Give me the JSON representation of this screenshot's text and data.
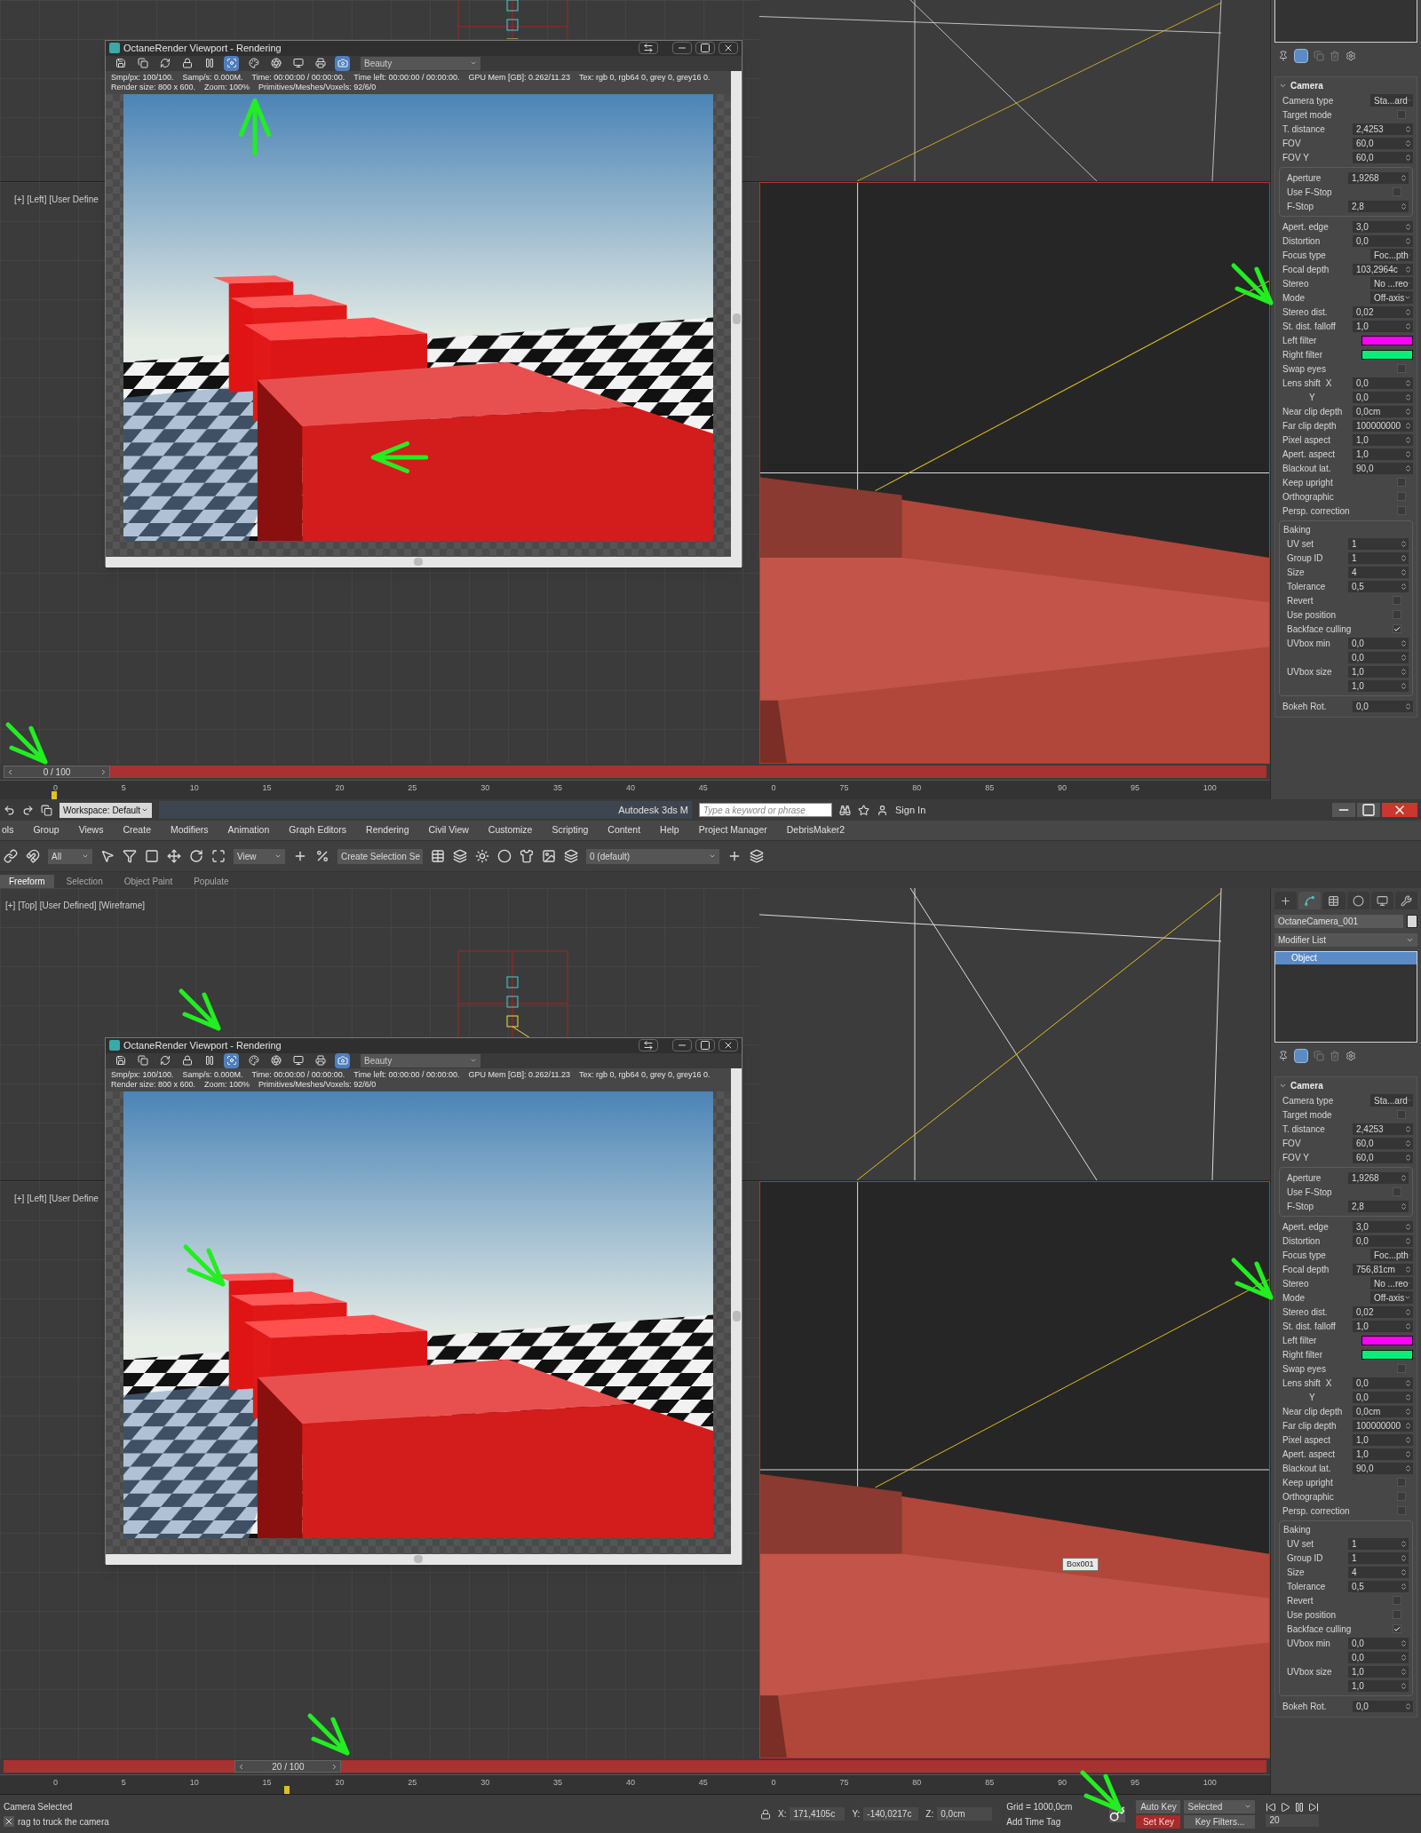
{
  "captures": [
    {
      "left_view_label": "[+] [Left] [User Define",
      "render_window": {
        "title": "OctaneRender Viewport - Rendering",
        "toolbar": [
          {
            "active": false
          },
          {
            "active": false
          },
          {
            "active": false
          },
          {
            "active": false
          },
          {
            "active": false
          },
          {
            "active": true
          },
          {
            "active": false
          },
          {
            "active": false
          },
          {
            "active": false
          },
          {
            "active": false
          },
          {
            "active": true
          }
        ],
        "pass": "Beauty",
        "stats_lines": [
          [
            "Smp/px: 100/100.",
            "Samp/s: 0.000M.",
            "Time: 00:00:00 / 00:00:00.",
            "Time left: 00:00:00 / 00:00:00.",
            "GPU Mem [GB]: 0.262/11.23",
            "Tex: rgb 0, rgb64 0, grey 0, grey16 0."
          ],
          [
            "Render size: 800 x 600.",
            "Zoom: 100%",
            "Primitives/Meshes/Voxels: 92/6/0"
          ]
        ]
      },
      "command_panel": {
        "camera": {
          "title": "Camera",
          "rows": [
            {
              "kind": "dropdown",
              "label": "Camera type",
              "value": "Sta...ard"
            },
            {
              "kind": "checkbox",
              "label": "Target mode",
              "checked": false
            },
            {
              "kind": "spinner",
              "label": "T. distance",
              "value": "2,4253"
            },
            {
              "kind": "spinner",
              "label": "FOV",
              "value": "60,0"
            },
            {
              "kind": "spinner",
              "label": "FOV Y",
              "value": "60,0"
            },
            {
              "kind": "group",
              "rows": [
                {
                  "kind": "spinner",
                  "label": "Aperture",
                  "value": "1,9268"
                },
                {
                  "kind": "checkbox",
                  "label": "Use F-Stop",
                  "checked": false
                },
                {
                  "kind": "spinner",
                  "label": "F-Stop",
                  "value": "2,8"
                }
              ]
            },
            {
              "kind": "spinner",
              "label": "Apert. edge",
              "value": "3,0"
            },
            {
              "kind": "spinner",
              "label": "Distortion",
              "value": "0,0"
            },
            {
              "kind": "dropdown",
              "label": "Focus type",
              "value": "Foc...pth"
            },
            {
              "kind": "spinner",
              "label": "Focal depth",
              "value": "103,2964c"
            },
            {
              "kind": "dropdown",
              "label": "Stereo",
              "value": "No ...reo"
            },
            {
              "kind": "dropdown",
              "label": "Mode",
              "value": "Off-axis"
            },
            {
              "kind": "spinner",
              "label": "Stereo dist.",
              "value": "0,02"
            },
            {
              "kind": "spinner",
              "label": "St. dist. falloff",
              "value": "1,0"
            },
            {
              "kind": "color",
              "label": "Left filter",
              "color": "#ff00ff"
            },
            {
              "kind": "color",
              "label": "Right filter",
              "color": "#00f07a"
            },
            {
              "kind": "checkbox",
              "label": "Swap eyes",
              "checked": false
            },
            {
              "kind": "spinner",
              "label": "Lens shift",
              "sublabel": "X",
              "value": "0,0"
            },
            {
              "kind": "spinner",
              "sublabel": "Y",
              "value": "0,0"
            },
            {
              "kind": "spinner",
              "label": "Near clip depth",
              "value": "0,0cm"
            },
            {
              "kind": "spinner",
              "label": "Far clip depth",
              "value": "100000000"
            },
            {
              "kind": "spinner",
              "label": "Pixel aspect",
              "value": "1,0"
            },
            {
              "kind": "spinner",
              "label": "Apert. aspect",
              "value": "1,0"
            },
            {
              "kind": "spinner",
              "label": "Blackout lat.",
              "value": "90,0"
            },
            {
              "kind": "checkbox",
              "label": "Keep upright",
              "checked": false
            },
            {
              "kind": "checkbox",
              "label": "Orthographic",
              "checked": false
            },
            {
              "kind": "checkbox",
              "label": "Persp. correction",
              "checked": false
            },
            {
              "kind": "group",
              "title": "Baking",
              "rows": [
                {
                  "kind": "spinner",
                  "label": "UV set",
                  "value": "1"
                },
                {
                  "kind": "spinner",
                  "label": "Group ID",
                  "value": "1"
                },
                {
                  "kind": "spinner",
                  "label": "Size",
                  "value": "4"
                },
                {
                  "kind": "spinner",
                  "label": "Tolerance",
                  "value": "0,5"
                },
                {
                  "kind": "checkbox",
                  "label": "Revert",
                  "checked": false
                },
                {
                  "kind": "checkbox",
                  "label": "Use position",
                  "checked": false
                },
                {
                  "kind": "checkbox",
                  "label": "Backface culling",
                  "checked": true
                },
                {
                  "kind": "spinner",
                  "label": "UVbox min",
                  "value": "0,0"
                },
                {
                  "kind": "spinner",
                  "value": "0,0"
                },
                {
                  "kind": "spinner",
                  "label": "UVbox size",
                  "value": "1,0"
                },
                {
                  "kind": "spinner",
                  "value": "1,0"
                }
              ]
            },
            {
              "kind": "spinner",
              "label": "Bokeh Rot.",
              "value": "0,0"
            }
          ]
        }
      },
      "timeline": {
        "label": "0 / 100",
        "level": 0,
        "ticks": [
          "0",
          "5",
          "10",
          "15",
          "20",
          "25",
          "30",
          "35",
          "40",
          "45",
          "0",
          "75",
          "80",
          "85",
          "90",
          "95",
          "100"
        ]
      }
    },
    {
      "top_view_label": "[+] [Top] [User Defined] [Wireframe]",
      "left_view_label": "[+] [Left] [User Define",
      "tooltip": "Box001",
      "render_window": {
        "title": "OctaneRender Viewport - Rendering",
        "toolbar": [
          {
            "active": false
          },
          {
            "active": false
          },
          {
            "active": false
          },
          {
            "active": false
          },
          {
            "active": false
          },
          {
            "active": true
          },
          {
            "active": false
          },
          {
            "active": false
          },
          {
            "active": false
          },
          {
            "active": false
          },
          {
            "active": true
          }
        ],
        "pass": "Beauty",
        "stats_lines": [
          [
            "Smp/px: 100/100.",
            "Samp/s: 0.000M.",
            "Time: 00:00:00 / 00:00:00.",
            "Time left: 00:00:00 / 00:00:00.",
            "GPU Mem [GB]: 0.262/11.23",
            "Tex: rgb 0, rgb64 0, grey 0, grey16 0."
          ],
          [
            "Render size: 800 x 600.",
            "Zoom: 100%",
            "Primitives/Meshes/Voxels: 92/6/0"
          ]
        ]
      },
      "command_panel": {
        "tabs": [
          {
            "selected": false
          },
          {
            "selected": true
          },
          {
            "selected": false
          },
          {
            "selected": false
          },
          {
            "selected": false
          },
          {
            "selected": false
          }
        ],
        "object_name": "OctaneCamera_001",
        "modifier_list": "Modifier List",
        "stack": [
          {
            "label": "Object",
            "selected": true
          }
        ],
        "camera": {
          "title": "Camera",
          "rows": [
            {
              "kind": "dropdown",
              "label": "Camera type",
              "value": "Sta...ard"
            },
            {
              "kind": "checkbox",
              "label": "Target mode",
              "checked": false
            },
            {
              "kind": "spinner",
              "label": "T. distance",
              "value": "2,4253"
            },
            {
              "kind": "spinner",
              "label": "FOV",
              "value": "60,0"
            },
            {
              "kind": "spinner",
              "label": "FOV Y",
              "value": "60,0"
            },
            {
              "kind": "group",
              "rows": [
                {
                  "kind": "spinner",
                  "label": "Aperture",
                  "value": "1,9268"
                },
                {
                  "kind": "checkbox",
                  "label": "Use F-Stop",
                  "checked": false
                },
                {
                  "kind": "spinner",
                  "label": "F-Stop",
                  "value": "2,8"
                }
              ]
            },
            {
              "kind": "spinner",
              "label": "Apert. edge",
              "value": "3,0"
            },
            {
              "kind": "spinner",
              "label": "Distortion",
              "value": "0,0"
            },
            {
              "kind": "dropdown",
              "label": "Focus type",
              "value": "Foc...pth"
            },
            {
              "kind": "spinner",
              "label": "Focal depth",
              "value": "756,81cm"
            },
            {
              "kind": "dropdown",
              "label": "Stereo",
              "value": "No ...reo"
            },
            {
              "kind": "dropdown",
              "label": "Mode",
              "value": "Off-axis"
            },
            {
              "kind": "spinner",
              "label": "Stereo dist.",
              "value": "0,02"
            },
            {
              "kind": "spinner",
              "label": "St. dist. falloff",
              "value": "1,0"
            },
            {
              "kind": "color",
              "label": "Left filter",
              "color": "#ff00ff"
            },
            {
              "kind": "color",
              "label": "Right filter",
              "color": "#00f07a"
            },
            {
              "kind": "checkbox",
              "label": "Swap eyes",
              "checked": false
            },
            {
              "kind": "spinner",
              "label": "Lens shift",
              "sublabel": "X",
              "value": "0,0"
            },
            {
              "kind": "spinner",
              "sublabel": "Y",
              "value": "0,0"
            },
            {
              "kind": "spinner",
              "label": "Near clip depth",
              "value": "0,0cm"
            },
            {
              "kind": "spinner",
              "label": "Far clip depth",
              "value": "100000000"
            },
            {
              "kind": "spinner",
              "label": "Pixel aspect",
              "value": "1,0"
            },
            {
              "kind": "spinner",
              "label": "Apert. aspect",
              "value": "1,0"
            },
            {
              "kind": "spinner",
              "label": "Blackout lat.",
              "value": "90,0"
            },
            {
              "kind": "checkbox",
              "label": "Keep upright",
              "checked": false
            },
            {
              "kind": "checkbox",
              "label": "Orthographic",
              "checked": false
            },
            {
              "kind": "checkbox",
              "label": "Persp. correction",
              "checked": false
            },
            {
              "kind": "group",
              "title": "Baking",
              "rows": [
                {
                  "kind": "spinner",
                  "label": "UV set",
                  "value": "1"
                },
                {
                  "kind": "spinner",
                  "label": "Group ID",
                  "value": "1"
                },
                {
                  "kind": "spinner",
                  "label": "Size",
                  "value": "4"
                },
                {
                  "kind": "spinner",
                  "label": "Tolerance",
                  "value": "0,5"
                },
                {
                  "kind": "checkbox",
                  "label": "Revert",
                  "checked": false
                },
                {
                  "kind": "checkbox",
                  "label": "Use position",
                  "checked": false
                },
                {
                  "kind": "checkbox",
                  "label": "Backface culling",
                  "checked": true
                },
                {
                  "kind": "spinner",
                  "label": "UVbox min",
                  "value": "0,0"
                },
                {
                  "kind": "spinner",
                  "value": "0,0"
                },
                {
                  "kind": "spinner",
                  "label": "UVbox size",
                  "value": "1,0"
                },
                {
                  "kind": "spinner",
                  "value": "1,0"
                }
              ]
            },
            {
              "kind": "spinner",
              "label": "Bokeh Rot.",
              "value": "0,0"
            }
          ]
        }
      },
      "timeline": {
        "label": "20 / 100",
        "level": 0.2,
        "ticks": [
          "0",
          "5",
          "10",
          "15",
          "20",
          "25",
          "30",
          "35",
          "40",
          "45",
          "0",
          "75",
          "80",
          "85",
          "90",
          "95",
          "100"
        ]
      }
    }
  ],
  "app_chrome": {
    "workspace": "Workspace: Default",
    "app_title": "Autodesk 3ds M",
    "search_placeholder": "Type a keyword or phrase",
    "sign_in": "Sign In",
    "menu": [
      "ols",
      "Group",
      "Views",
      "Create",
      "Modifiers",
      "Animation",
      "Graph Editors",
      "Rendering",
      "Civil View",
      "Customize",
      "Scripting",
      "Content",
      "Help",
      "Project Manager",
      "DebrisMaker2"
    ],
    "selection_filter": "All",
    "coord_system": "View",
    "selection_set": "Create Selection Se",
    "layer": "0 (default)",
    "ribbon_tabs": [
      {
        "label": "Freeform",
        "selected": true
      },
      {
        "label": "Selection",
        "selected": false
      },
      {
        "label": "Object Paint",
        "selected": false
      },
      {
        "label": "Populate",
        "selected": false
      }
    ]
  },
  "status_bar": {
    "messages": [
      "Camera Selected",
      "rag to truck the camera"
    ],
    "coords": [
      {
        "label": "X:",
        "value": "171,4105c"
      },
      {
        "label": "Y:",
        "value": "-140,0217c"
      },
      {
        "label": "Z:",
        "value": "0,0cm"
      }
    ],
    "grid": "Grid = 1000,0cm",
    "time_tag": "Add Time Tag",
    "auto_key": "Auto Key",
    "key_mode": "Selected",
    "set_key": "Set Key",
    "key_filters": "Key Filters...",
    "frame": "20"
  }
}
